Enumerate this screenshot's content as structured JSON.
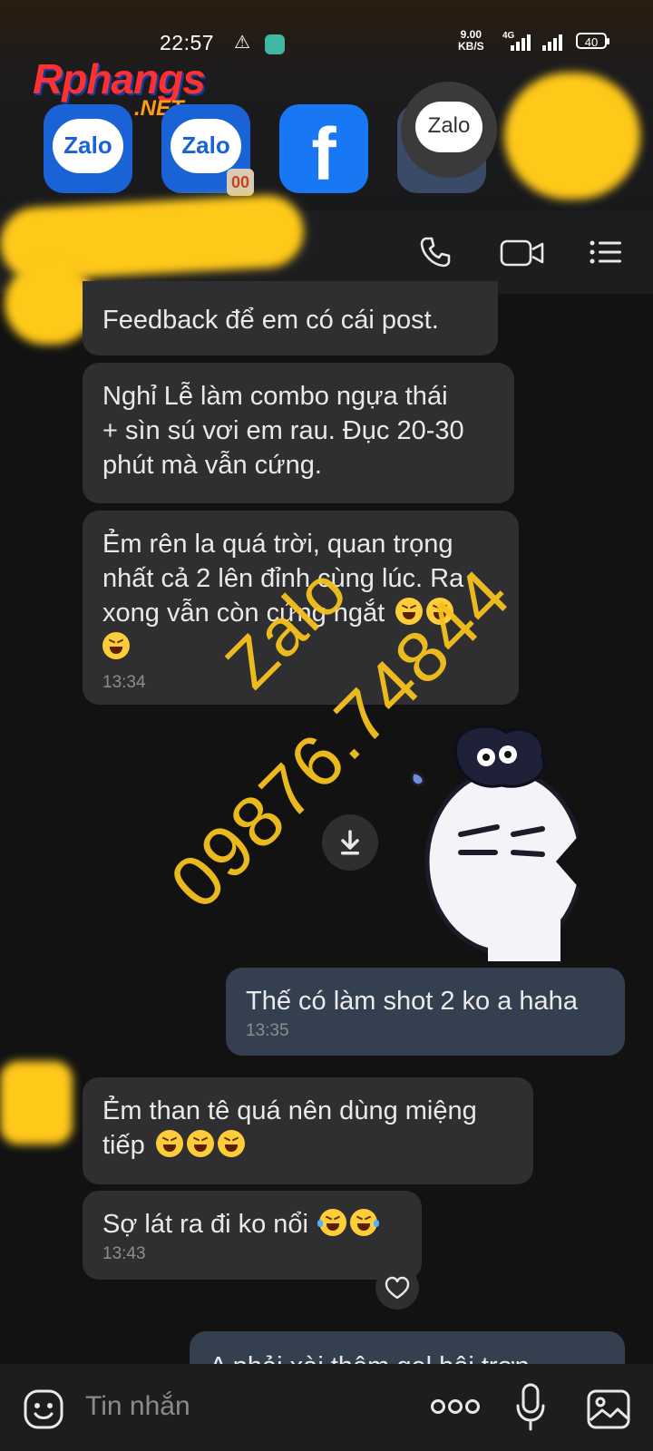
{
  "status_bar": {
    "time": "22:57",
    "net_speed_value": "9.00",
    "net_speed_unit": "KB/S",
    "network_type": "4G",
    "battery": "40"
  },
  "watermark_brand": {
    "name": "Rphangs",
    "suffix": ".NET"
  },
  "app_switcher": {
    "zalo_label": "Zalo",
    "floating_bubble_label": "Zalo",
    "facebook_glyph": "f",
    "dual_badge": "00"
  },
  "chat_header": {
    "icons": [
      "phone-icon",
      "video-call-icon",
      "menu-icon"
    ]
  },
  "messages": [
    {
      "id": "m1",
      "direction": "incoming",
      "text": "Feedback để em có cái post."
    },
    {
      "id": "m2",
      "direction": "incoming",
      "lines": [
        "Nghỉ Lễ làm combo ngựa thái",
        "+ sìn sú vơi em rau. Đục 20-30",
        "phút mà vẫn cứng."
      ]
    },
    {
      "id": "m3",
      "direction": "incoming",
      "lines": [
        "Ẻm rên la quá trời, quan trọng",
        "nhất cả 2 lên đỉnh cùng lúc. Ra",
        "xong vẫn còn cứng ngắt"
      ],
      "time": "13:34"
    },
    {
      "id": "m4",
      "direction": "outgoing",
      "text": "Thế có làm shot 2 ko a haha",
      "time": "13:35"
    },
    {
      "id": "m5",
      "direction": "incoming",
      "lines": [
        "Ẻm than tê quá nên dùng miệng",
        "tiếp"
      ]
    },
    {
      "id": "m6",
      "direction": "incoming",
      "text": "Sợ lát ra đi ko nổi",
      "time": "13:43"
    },
    {
      "id": "m7",
      "direction": "outgoing",
      "text": "A phải xài thêm gel bôi trơn"
    }
  ],
  "overlay_watermark": {
    "line1": "Zalo",
    "line2": "09876.74844"
  },
  "input_bar": {
    "placeholder": "Tin nhắn",
    "icons": [
      "emoji-icon",
      "more-icon",
      "microphone-icon",
      "image-icon"
    ]
  },
  "colors": {
    "background": "#121212",
    "incoming_bubble": "#2f2f31",
    "outgoing_bubble": "#34404f",
    "watermark": "#f5c21f",
    "zalo_blue": "#1a63d6"
  }
}
